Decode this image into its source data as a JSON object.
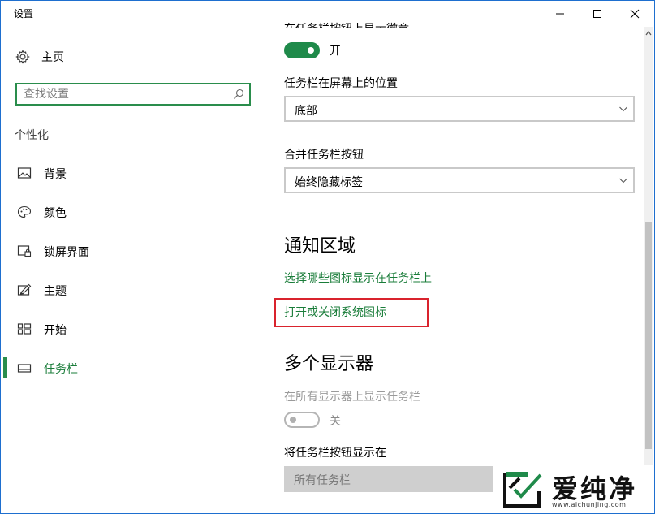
{
  "window": {
    "title": "设置"
  },
  "sidebar": {
    "home_label": "主页",
    "search_placeholder": "查找设置",
    "section_label": "个性化",
    "items": [
      {
        "label": "背景",
        "icon": "picture-icon"
      },
      {
        "label": "颜色",
        "icon": "palette-icon"
      },
      {
        "label": "锁屏界面",
        "icon": "lock-screen-icon"
      },
      {
        "label": "主题",
        "icon": "theme-brush-icon"
      },
      {
        "label": "开始",
        "icon": "start-grid-icon"
      },
      {
        "label": "任务栏",
        "icon": "taskbar-icon",
        "active": true
      }
    ]
  },
  "content": {
    "partial_heading": "在任务栏按钮上显示徽章",
    "badge_toggle": {
      "state": "开",
      "on": true
    },
    "position": {
      "label": "任务栏在屏幕上的位置",
      "value": "底部"
    },
    "combine": {
      "label": "合并任务栏按钮",
      "value": "始终隐藏标签"
    },
    "notification_area": {
      "heading": "通知区域",
      "link_icons": "选择哪些图标显示在任务栏上",
      "link_system_icons": "打开或关闭系统图标"
    },
    "multi_display": {
      "heading": "多个显示器",
      "show_all_label": "在所有显示器上显示任务栏",
      "toggle": {
        "state": "关",
        "on": false
      },
      "buttons_on_label": "将任务栏按钮显示在",
      "buttons_on_value": "所有任务栏"
    }
  },
  "watermark": {
    "name": "爱纯净",
    "url": "www.aichunjing.com"
  },
  "colors": {
    "accent": "#1f8a4a",
    "highlight_box": "#d9232d"
  }
}
